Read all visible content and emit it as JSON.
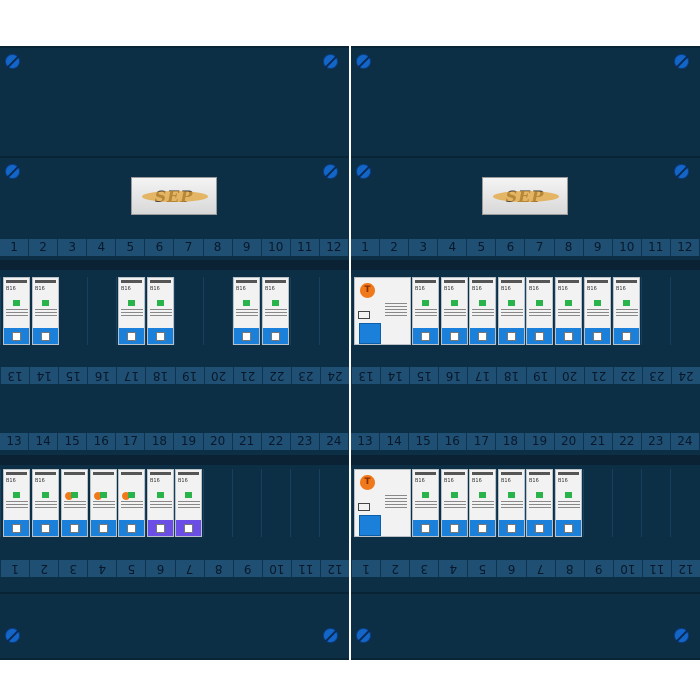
{
  "brand": "SEP",
  "panels": [
    {
      "name": "left",
      "top_row_labels": [
        "1",
        "2",
        "3",
        "4",
        "5",
        "6",
        "7",
        "8",
        "9",
        "10",
        "11",
        "12"
      ],
      "top_row_lower_labels": [
        "24",
        "23",
        "22",
        "21",
        "20",
        "19",
        "18",
        "17",
        "16",
        "15",
        "14",
        "13"
      ],
      "bottom_row_labels": [
        "13",
        "14",
        "15",
        "16",
        "17",
        "18",
        "19",
        "20",
        "21",
        "22",
        "23",
        "24"
      ],
      "bottom_row_lower_labels": [
        "12",
        "11",
        "10",
        "9",
        "8",
        "7",
        "6",
        "5",
        "4",
        "3",
        "2",
        "1"
      ],
      "mcb_rating": "B16"
    },
    {
      "name": "right",
      "top_row_labels": [
        "1",
        "2",
        "3",
        "4",
        "5",
        "6",
        "7",
        "8",
        "9",
        "10",
        "11",
        "12"
      ],
      "top_row_lower_labels": [
        "24",
        "23",
        "22",
        "21",
        "20",
        "19",
        "18",
        "17",
        "16",
        "15",
        "14",
        "13"
      ],
      "bottom_row_labels": [
        "13",
        "14",
        "15",
        "16",
        "17",
        "18",
        "19",
        "20",
        "21",
        "22",
        "23",
        "24"
      ],
      "bottom_row_lower_labels": [
        "12",
        "11",
        "10",
        "9",
        "8",
        "7",
        "6",
        "5",
        "4",
        "3",
        "2",
        "1"
      ],
      "mcb_rating": "B16",
      "rcd_label": "T"
    }
  ],
  "colors": {
    "panel": "#0c2f45",
    "strip": "#1f4f73",
    "module_blue": "#1a80d9",
    "screw": "#1366c8"
  }
}
